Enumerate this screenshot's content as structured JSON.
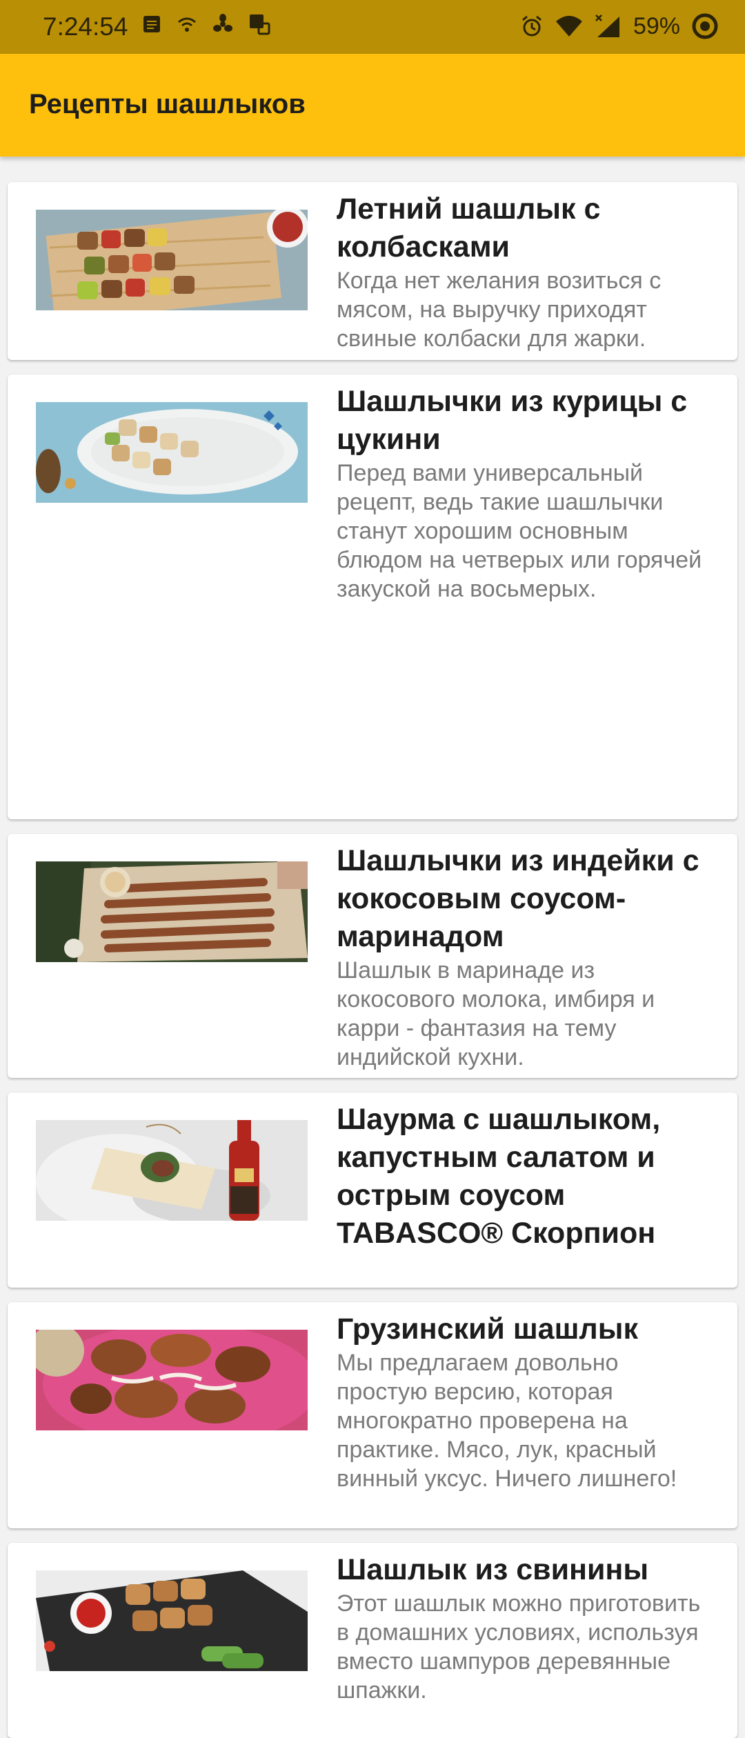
{
  "status_bar": {
    "time": "7:24:54",
    "battery": "59%",
    "icons": [
      "notes-icon",
      "wifi-calling-icon",
      "fan-icon",
      "sync-icon",
      "alarm-icon",
      "wifi-icon",
      "signal-icon",
      "battery-saver-icon"
    ]
  },
  "app_bar": {
    "title": "Рецепты шашлыков"
  },
  "recipes": [
    {
      "title": "Летний шашлык с колбасками",
      "description": "Когда нет желания возиться с мясом, на выручку приходят свиные колбаски для жарки."
    },
    {
      "title": "Шашлычки из курицы с цукини",
      "description": "Перед вами универсальный рецепт, ведь такие шашлычки станут хорошим основным блюдом на четверых или горячей закуской на восьмерых."
    },
    {
      "title": "Шашлычки из индейки с кокосовым соусом-маринадом",
      "description": "Шашлык в маринаде из кокосового молока, имбиря и карри - фантазия на тему индийской кухни."
    },
    {
      "title": "Шаурма с шашлыком, капустным салатом и острым соусом TABASCO® Скорпион",
      "description": ""
    },
    {
      "title": "Грузинский шашлык",
      "description": "Мы предлагаем довольно простую версию, которая многократно проверена на практике. Мясо, лук, красный винный уксус. Ничего лишнего!"
    },
    {
      "title": "Шашлык из свинины",
      "description": "Этот шашлык можно приготовить в домашних условиях, используя вместо шампуров деревянные шпажки."
    }
  ],
  "colors": {
    "status_bar": "#b98f05",
    "app_bar": "#fec00c",
    "background": "#f2f2f2"
  }
}
